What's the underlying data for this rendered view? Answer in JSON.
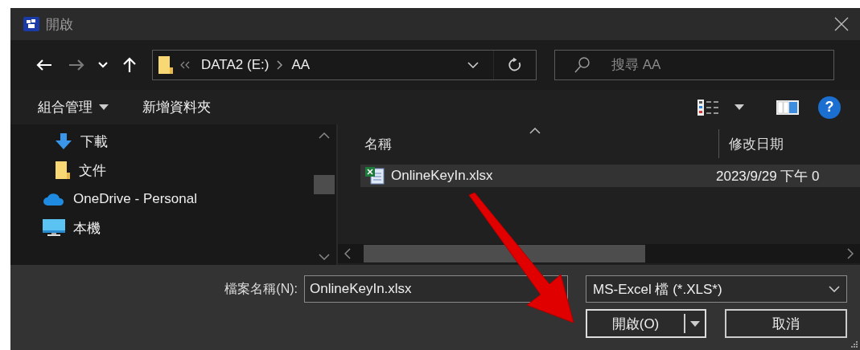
{
  "window": {
    "title": "開啟"
  },
  "nav_buttons": [
    {
      "kind": "back",
      "disabled": false
    },
    {
      "kind": "forward",
      "disabled": true
    },
    {
      "kind": "recent",
      "disabled": false
    },
    {
      "kind": "up",
      "disabled": false
    }
  ],
  "address": {
    "crumbs": [
      "DATA2 (E:)",
      "AA"
    ]
  },
  "search": {
    "placeholder": "搜尋 AA"
  },
  "toolbar": {
    "organize": "組合管理",
    "new_folder": "新增資料夾",
    "help": "?"
  },
  "sidebar": {
    "items": [
      {
        "kind": "group",
        "children": [
          {
            "label": "下載",
            "kind": "downloads"
          },
          {
            "label": "文件",
            "kind": "documents"
          }
        ]
      },
      {
        "label": "OneDrive - Personal",
        "kind": "cloud"
      },
      {
        "label": "本機",
        "kind": "computer"
      }
    ]
  },
  "files": {
    "columns": [
      {
        "label": "名稱",
        "sorted": true
      },
      {
        "label": "修改日期",
        "sorted": false
      }
    ],
    "rows": [
      {
        "name": "OnlineKeyIn.xlsx",
        "modified": "2023/9/29 下午 0",
        "selected": true
      }
    ]
  },
  "footer": {
    "filename_label": "檔案名稱(N):",
    "filename": "OnlineKeyIn.xlsx",
    "filetype": "MS-Excel 檔 (*.XLS*)",
    "open": "開啟(O)",
    "cancel": "取消"
  }
}
